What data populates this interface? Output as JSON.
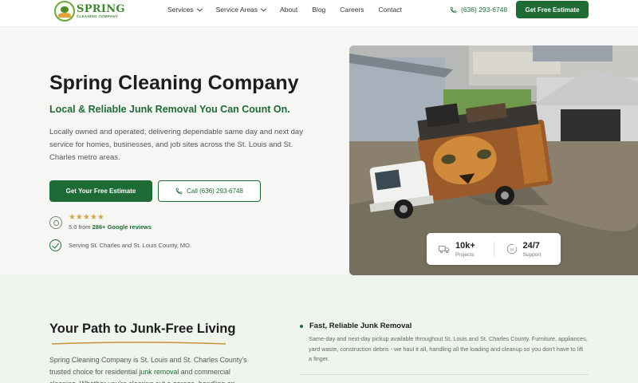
{
  "brand": {
    "name": "SPRING",
    "tagline": "CLEANING COMPANY"
  },
  "nav": {
    "items": [
      {
        "label": "Services",
        "has_dropdown": true
      },
      {
        "label": "Service Areas",
        "has_dropdown": true
      },
      {
        "label": "About",
        "has_dropdown": false
      },
      {
        "label": "Blog",
        "has_dropdown": false
      },
      {
        "label": "Careers",
        "has_dropdown": false
      },
      {
        "label": "Contact",
        "has_dropdown": false
      }
    ],
    "phone": "(636) 293-6748",
    "cta": "Get Free Estimate"
  },
  "hero": {
    "title": "Spring Cleaning Company",
    "subtitle": "Local & Reliable Junk Removal You Can Count On.",
    "description": "Locally owned and operated, delivering dependable same day and next day service for homes, businesses, and job sites across the St. Louis and St. Charles metro areas.",
    "cta_primary": "Get Your Free Estimate",
    "cta_call": "Call (636) 293-6748",
    "rating": {
      "stars": "★★★★★",
      "score_text": "5.0 from",
      "reviews_text": "286+ Google reviews"
    },
    "serving": "Serving St. Charles and St. Louis County, MO."
  },
  "stats": [
    {
      "value": "10k+",
      "label": "Projects",
      "icon": "truck-icon"
    },
    {
      "value": "24/7",
      "label": "Support",
      "icon": "clock-24-icon"
    }
  ],
  "path_section": {
    "title": "Your Path to Junk-Free Living",
    "text_before": "Spring Cleaning Company is St. Louis and St. Charles County's trusted choice for residential ",
    "link": "junk removal",
    "text_after": " and commercial cleaning. Whether you're clearing out a garage, handling an",
    "feature": {
      "title": "Fast, Reliable Junk Removal",
      "text": "Same-day and next-day pickup available throughout St. Louis and St. Charles County. Furniture, appliances, yard waste, construction debris - we haul it all, handling all the loading and cleanup so you don't have to lift a finger."
    }
  },
  "colors": {
    "brand_green": "#1e6b35",
    "star_gold": "#d4a54a",
    "hero_bg": "#f6f6f4",
    "section_bg": "#eef5ec"
  }
}
